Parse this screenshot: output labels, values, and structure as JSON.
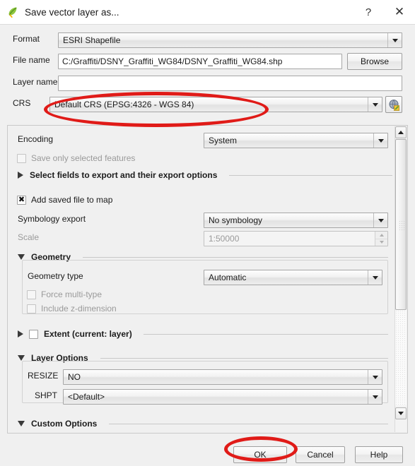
{
  "window": {
    "title": "Save vector layer as...",
    "icon": "qgis-logo-icon",
    "help_btn": "?",
    "close_btn": "✕"
  },
  "form": {
    "format": {
      "label": "Format",
      "value": "ESRI Shapefile"
    },
    "file_name": {
      "label": "File name",
      "value": "C:/Graffiti/DSNY_Graffiti_WG84/DSNY_Graffiti_WG84.shp",
      "browse": "Browse"
    },
    "layer_name": {
      "label": "Layer name",
      "value": "",
      "placeholder": ""
    },
    "crs": {
      "label": "CRS",
      "value": "Default CRS (EPSG:4326 - WGS 84)"
    }
  },
  "options": {
    "encoding": {
      "label": "Encoding",
      "value": "System"
    },
    "save_only_selected": {
      "label": "Save only selected features",
      "checked": false,
      "enabled": false,
      "mark": ""
    },
    "select_fields": {
      "label": "Select fields to export and their export options",
      "expanded": false
    },
    "add_saved_file": {
      "label": "Add saved file to map",
      "checked": true,
      "mark": "✖"
    },
    "symbology_export": {
      "label": "Symbology export",
      "value": "No symbology"
    },
    "scale": {
      "label": "Scale",
      "value": "1:50000",
      "enabled": false
    },
    "geometry": {
      "title": "Geometry",
      "expanded": true,
      "geometry_type": {
        "label": "Geometry type",
        "value": "Automatic"
      },
      "force_multi": {
        "label": "Force multi-type",
        "checked": false,
        "enabled": false
      },
      "include_z": {
        "label": "Include z-dimension",
        "checked": false,
        "enabled": false
      }
    },
    "extent": {
      "label": "Extent (current: layer)",
      "checked": false,
      "expanded": false
    },
    "layer_options": {
      "title": "Layer Options",
      "expanded": true,
      "rows": [
        {
          "label": "RESIZE",
          "value": "NO"
        },
        {
          "label": "SHPT",
          "value": "<Default>"
        }
      ]
    },
    "custom_options": {
      "title": "Custom Options",
      "expanded": true
    }
  },
  "buttons": {
    "ok": "OK",
    "cancel": "Cancel",
    "help": "Help"
  },
  "annotations": {
    "highlight_color": "#e01b18",
    "targets": [
      "crs-combo",
      "ok-button"
    ]
  }
}
